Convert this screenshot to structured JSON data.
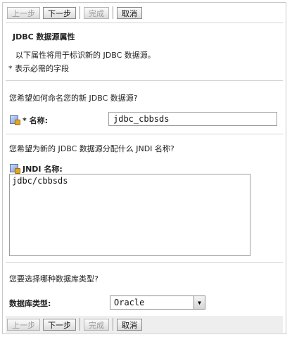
{
  "toolbar": {
    "back": "上一步",
    "next": "下一步",
    "finish": "完成",
    "cancel": "取消"
  },
  "section": {
    "title": "JDBC 数据源属性",
    "description": "以下属性将用于标识新的 JDBC 数据源。",
    "required_note": "* 表示必需的字段"
  },
  "name_question": "您希望如何命名您的新 JDBC 数据源?",
  "name_field": {
    "label": "* 名称:",
    "value": "jdbc_cbbsds"
  },
  "jndi_question": "您希望为新的 JDBC 数据源分配什么 JNDI 名称?",
  "jndi_field": {
    "label": "JNDI 名称:",
    "value": "jdbc/cbbsds"
  },
  "db_question": "您要选择哪种数据库类型?",
  "db_field": {
    "label": "数据库类型:",
    "value": "Oracle"
  },
  "icons": {
    "field_help": "info-icon"
  }
}
